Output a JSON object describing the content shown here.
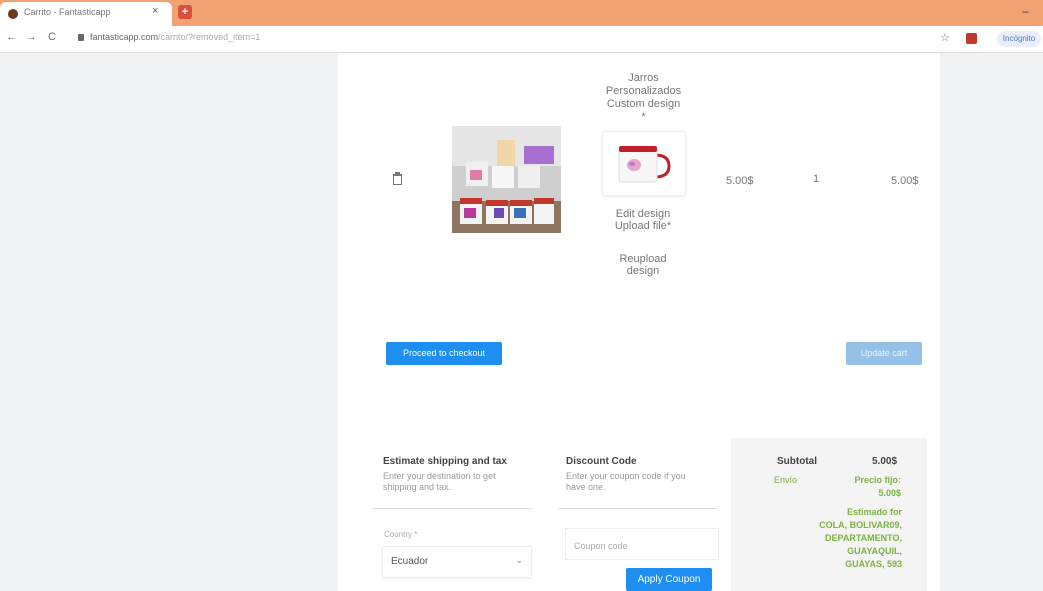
{
  "browser": {
    "tab_title": "Carrito - Fantasticapp",
    "tab_close": "×",
    "new_tab": "+",
    "window_minimize": "–",
    "back": "←",
    "forward": "→",
    "reload": "C",
    "url_domain": "fantasticapp.com",
    "url_path": "/carrito/?removed_item=1",
    "bookmark": "☆",
    "profile_label": "Incógnito"
  },
  "cart_item": {
    "product_name": "Jarros Personalizados Custom design",
    "asterisk": "*",
    "edit_design": "Edit design",
    "upload_file": "Upload file*",
    "reupload_design": "Reupload design",
    "price": "5.00$",
    "quantity": "1",
    "subtotal": "5.00$"
  },
  "actions": {
    "proceed": "Proceed to checkout",
    "update_cart": "Update cart"
  },
  "shipping": {
    "title": "Estimate shipping and tax",
    "subtitle": "Enter your destination to get shipping and tax.",
    "country_label": "Country *",
    "country_value": "Ecuador",
    "chevron": "⌄"
  },
  "discount": {
    "title": "Discount Code",
    "subtitle": "Enter your coupon code if you have one.",
    "placeholder": "Coupon code",
    "apply": "Apply Coupon"
  },
  "summary": {
    "subtotal_label": "Subtotal",
    "subtotal_value": "5.00$",
    "shipping_label": "Envío",
    "shipping_value": "Precio fijo: 5.00$",
    "estimate_text": "Estimado for COLA, BOLIVAR09, DEPARTAMENTO, GUAYAQUIL, GUAYAS, 593"
  },
  "colors": {
    "tabbar": "#f2a173",
    "primary_button": "#1f8ef1",
    "muted_button": "#95c1e8",
    "green_text": "#7cb342"
  }
}
